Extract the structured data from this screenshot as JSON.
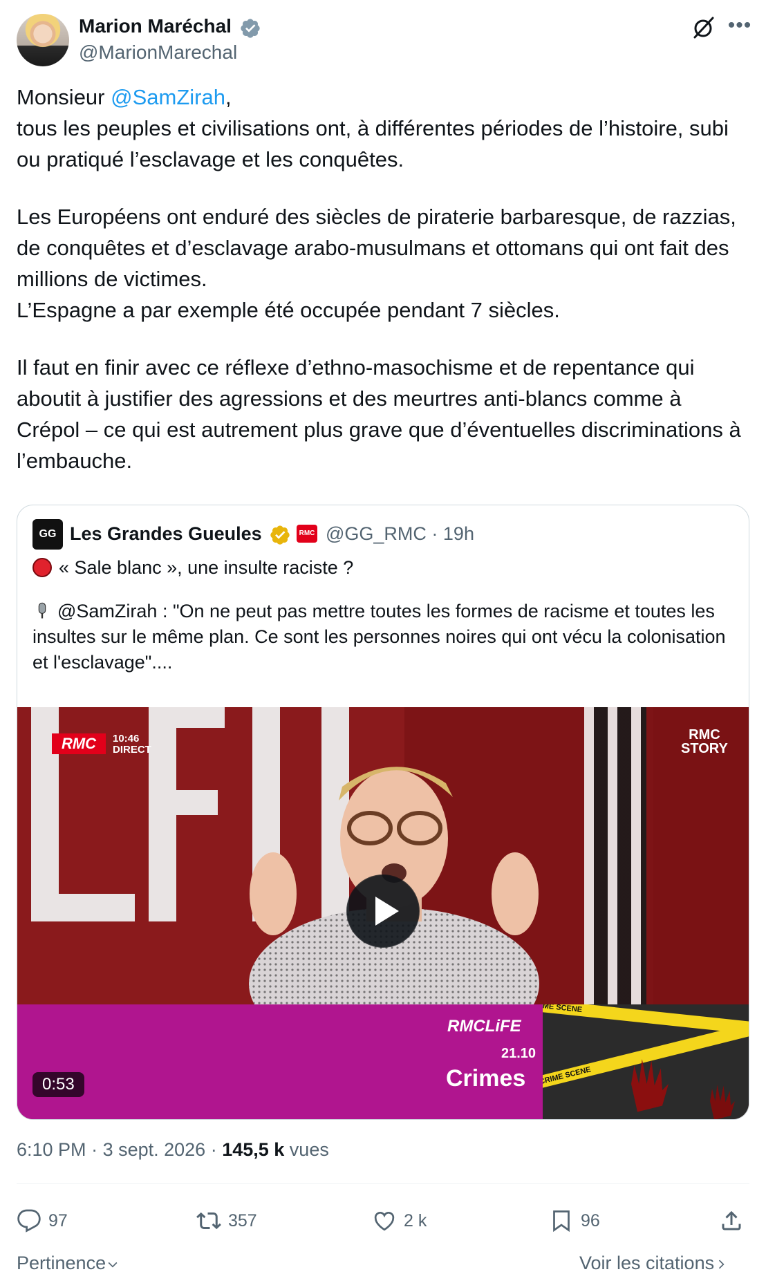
{
  "author": {
    "name": "Marion Maréchal",
    "handle": "@MarionMarechal"
  },
  "tweet": {
    "mention_prefix": "Monsieur ",
    "mention": "@SamZirah",
    "mention_suffix": ",",
    "line1": "tous les peuples et civilisations ont, à différentes périodes de l’histoire, subi ou pratiqué l’esclavage et les conquêtes.",
    "para2": "Les Européens ont enduré des siècles de piraterie barbaresque, de razzias, de conquêtes et d’esclavage arabo-musulmans et ottomans qui ont fait des millions de victimes.\nL’Espagne a par exemple été occupée pendant 7 siècles.",
    "para3": "Il faut en finir avec ce réflexe d’ethno-masochisme et de repentance qui aboutit à justifier des agressions et des meurtres anti-blancs comme à Crépol – ce qui est autrement plus grave que d’éventuelles discriminations à l’embauche."
  },
  "quoted": {
    "avatar_text": "GG",
    "name": "Les Grandes Gueules",
    "affiliate_badge": "RMC",
    "meta": "@GG_RMC · 19h",
    "line1": "« Sale blanc », une insulte raciste ?",
    "line2": "@SamZirah : \"On ne peut pas mettre toutes les formes de racisme et toutes les insultes sur le même plan. Ce sont les personnes noires qui ont vécu la colonisation et l'esclavage\"....",
    "video": {
      "duration": "0:53",
      "rmc_logo": "RMC",
      "rmc_time": "10:46",
      "rmc_direct": "DIRECT",
      "rmc_story_1": "RMC",
      "rmc_story_2": "STORY",
      "life_logo": "RMCLiFE",
      "life_date": "21.10",
      "life_title": "Crimes",
      "tape_text": "CRIME SCENE"
    }
  },
  "footer": {
    "time": "6:10 PM",
    "date": "3 sept. 2026",
    "views_count": "145,5 k",
    "views_label": "vues"
  },
  "actions": {
    "replies": "97",
    "reposts": "357",
    "likes": "2 k",
    "bookmarks": "96"
  },
  "bottom": {
    "sort_label": "Pertinence",
    "quotes_label": "Voir les citations"
  },
  "colors": {
    "accent": "#1d9bf0",
    "text": "#0f1419",
    "muted": "#536471",
    "verified": "#829aab",
    "gold": "#e8b50c"
  }
}
